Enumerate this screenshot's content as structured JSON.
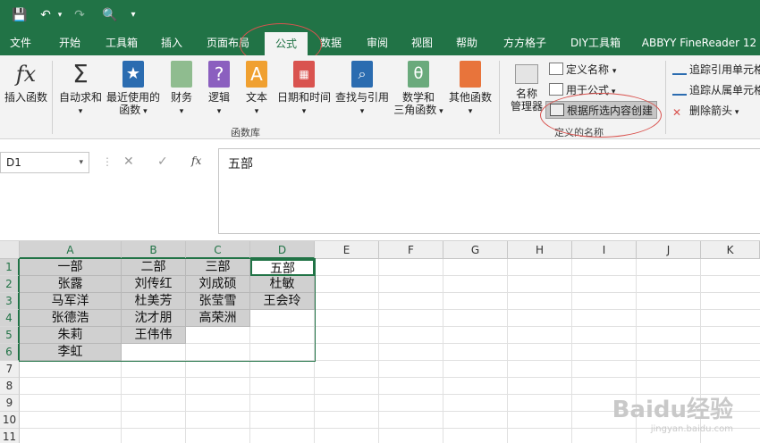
{
  "qat": {
    "save": "💾",
    "undo": "↶",
    "redo": "↷",
    "preview": "🔍",
    "more": "▾"
  },
  "tabs": [
    "文件",
    "开始",
    "工具箱",
    "插入",
    "页面布局",
    "公式",
    "数据",
    "审阅",
    "视图",
    "帮助",
    "方方格子",
    "DIY工具箱",
    "ABBYY FineReader 12"
  ],
  "active_tab": "公式",
  "ribbon": {
    "insert_function": "插入函数",
    "autosum": "自动求和",
    "recent_1": "最近使用的",
    "recent_2": "函数",
    "financial": "财务",
    "logical": "逻辑",
    "text": "文本",
    "datetime": "日期和时间",
    "lookup": "查找与引用",
    "math_1": "数学和",
    "math_2": "三角函数",
    "other": "其他函数",
    "library_label": "函数库",
    "name_mgr_1": "名称",
    "name_mgr_2": "管理器",
    "define_name": "定义名称",
    "use_in_formula": "用于公式",
    "create_from_selection": "根据所选内容创建",
    "defined_names_label": "定义的名称",
    "trace_precedents": "追踪引用单元格",
    "trace_dependents": "追踪从属单元格",
    "remove_arrows": "删除箭头"
  },
  "formula_bar": {
    "name_box": "D1",
    "cancel": "✕",
    "enter": "✓",
    "fx": "fx",
    "content": "五部"
  },
  "columns": [
    "A",
    "B",
    "C",
    "D",
    "E",
    "F",
    "G",
    "H",
    "I",
    "J",
    "K"
  ],
  "rows": [
    "1",
    "2",
    "3",
    "4",
    "5",
    "6",
    "7",
    "8",
    "9",
    "10",
    "11"
  ],
  "cells": {
    "A": [
      "一部",
      "张露",
      "马军洋",
      "张德浩",
      "朱莉",
      "李虹"
    ],
    "B": [
      "二部",
      "刘传红",
      "杜美芳",
      "沈才朋",
      "王伟伟"
    ],
    "C": [
      "三部",
      "刘成硕",
      "张莹雪",
      "高荣洲"
    ],
    "D": [
      "五部",
      "杜敏",
      "王会玲"
    ]
  },
  "watermark": {
    "brand": "Baidu经验",
    "url": "jingyan.baidu.com"
  }
}
